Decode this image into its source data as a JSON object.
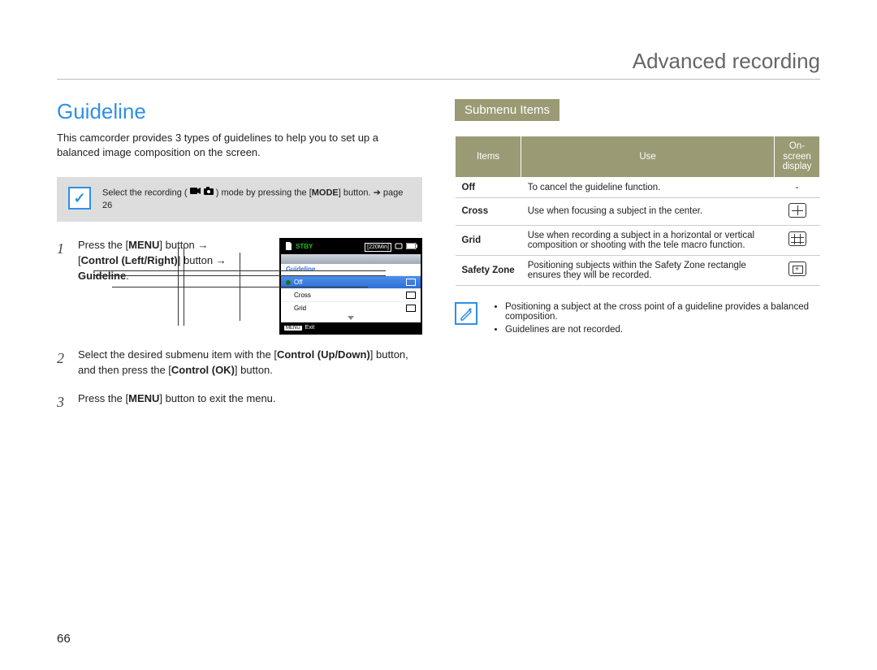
{
  "header": {
    "chapter": "Advanced recording"
  },
  "page_number": "66",
  "left": {
    "title": "Guideline",
    "intro": "This camcorder provides 3 types of guidelines to help you to set up a balanced image composition on the screen.",
    "note": {
      "prefix": "Select the recording ( ",
      "suffix": " ) mode by pressing the ",
      "mode_label": "MODE",
      "button_word": " button. ",
      "page_ref": "page 26"
    },
    "steps": [
      {
        "parts": [
          "Press the [",
          "MENU",
          "] button ",
          "→",
          " [",
          "Control (Left/Right)",
          "] button ",
          "→",
          " ",
          "Guideline",
          "."
        ]
      },
      {
        "parts": [
          "Select the desired submenu item with the [",
          "Control (Up/Down)",
          "] button, and then press the [",
          "Control (OK)",
          "] button."
        ]
      },
      {
        "parts": [
          "Press the [",
          "MENU",
          "] button to exit the menu."
        ]
      }
    ],
    "lcd": {
      "stby": "STBY",
      "time": "[220Min]",
      "title": "Guideline",
      "rows": [
        {
          "label": "Off",
          "selected": true
        },
        {
          "label": "Cross",
          "selected": false
        },
        {
          "label": "Grid",
          "selected": false
        }
      ],
      "exit_btn": "MENU",
      "exit_label": "Exit"
    }
  },
  "right": {
    "submenu_heading": "Submenu Items",
    "table": {
      "headers": [
        "Items",
        "Use",
        "On-screen display"
      ],
      "rows": [
        {
          "item": "Off",
          "use": "To cancel the guideline function.",
          "osd": "dash"
        },
        {
          "item": "Cross",
          "use": "Use when focusing a subject in the center.",
          "osd": "cross"
        },
        {
          "item": "Grid",
          "use": "Use when recording a subject in a horizontal or vertical composition or shooting with the tele macro function.",
          "osd": "grid"
        },
        {
          "item": "Safety Zone",
          "use": "Positioning subjects within the Safety Zone rectangle ensures they will be recorded.",
          "osd": "safe"
        }
      ]
    },
    "tips": [
      "Positioning a subject at the cross point of a guideline provides a balanced composition.",
      "Guidelines are not recorded."
    ]
  }
}
